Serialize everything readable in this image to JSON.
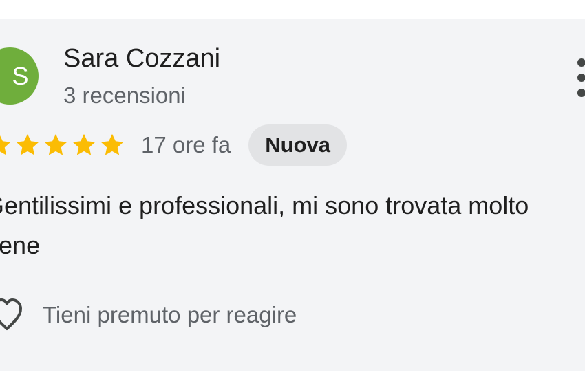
{
  "review": {
    "avatar_letter": "S",
    "avatar_color": "#6fae3c",
    "author_name": "Sara Cozzani",
    "review_count": "3 recensioni",
    "rating": 5,
    "rating_max": 5,
    "star_color": "#fbbc04",
    "time_ago": "17 ore fa",
    "badge": "Nuova",
    "text": "Gentilissimi e professionali, mi sono trovata molto bene",
    "react_hint": "Tieni premuto per reagire",
    "icons": {
      "more": "more-vert-icon",
      "star": "star-icon",
      "react": "heart-outline-icon"
    }
  }
}
